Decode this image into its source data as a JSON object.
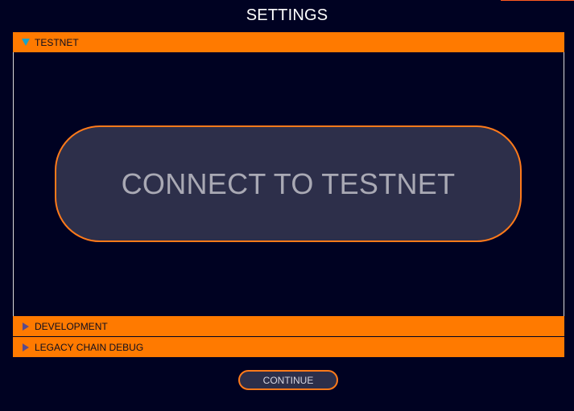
{
  "title": "SETTINGS",
  "sections": [
    {
      "label": "TESTNET",
      "expanded": true,
      "icon": "triangle-down-icon"
    },
    {
      "label": "DEVELOPMENT",
      "expanded": false,
      "icon": "triangle-right-icon"
    },
    {
      "label": "LEGACY CHAIN DEBUG",
      "expanded": false,
      "icon": "triangle-right-icon"
    }
  ],
  "testnet": {
    "connect_label": "CONNECT TO TESTNET"
  },
  "footer": {
    "continue_label": "CONTINUE"
  },
  "colors": {
    "background": "#000222",
    "accent": "#ff7a00",
    "button_fill": "#2d2f4a",
    "expanded_arrow": "#1aa3c9"
  }
}
